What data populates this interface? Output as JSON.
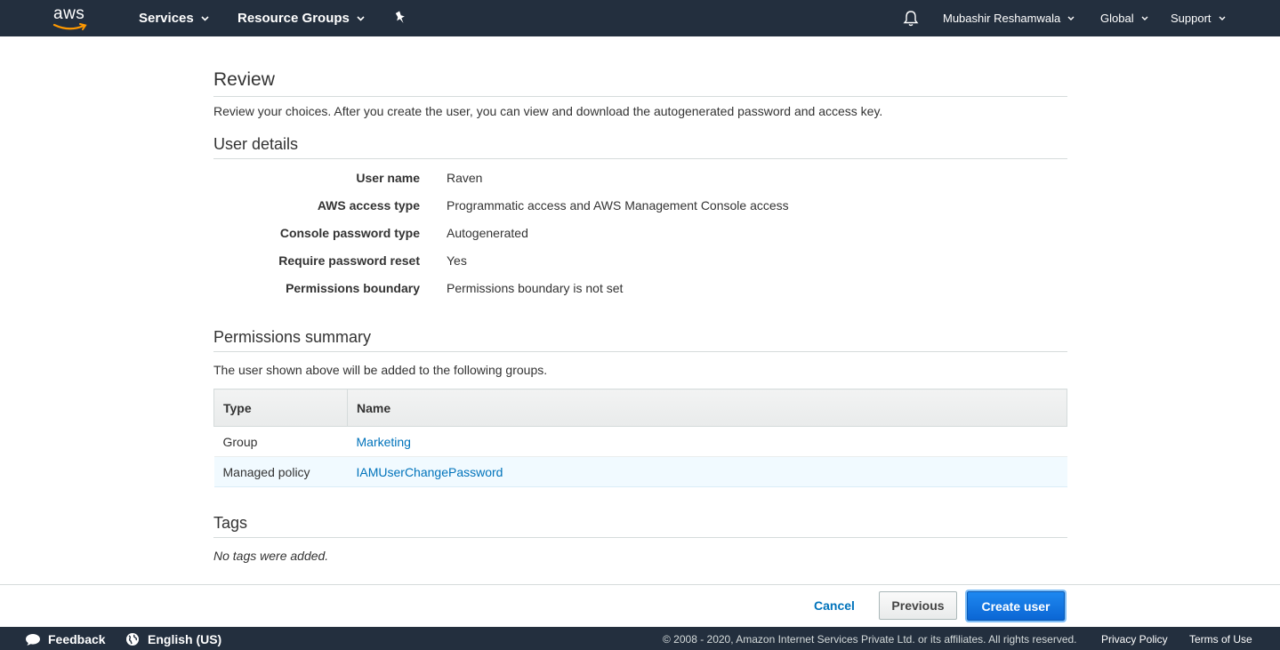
{
  "nav": {
    "logo_text": "aws",
    "services": "Services",
    "resource_groups": "Resource Groups",
    "user": "Mubashir Reshamwala",
    "region": "Global",
    "support": "Support"
  },
  "review": {
    "title": "Review",
    "description": "Review your choices. After you create the user, you can view and download the autogenerated password and access key."
  },
  "user_details": {
    "heading": "User details",
    "rows": [
      {
        "label": "User name",
        "value": "Raven"
      },
      {
        "label": "AWS access type",
        "value": "Programmatic access and AWS Management Console access"
      },
      {
        "label": "Console password type",
        "value": "Autogenerated"
      },
      {
        "label": "Require password reset",
        "value": "Yes"
      },
      {
        "label": "Permissions boundary",
        "value": "Permissions boundary is not set"
      }
    ]
  },
  "permissions": {
    "heading": "Permissions summary",
    "description": "The user shown above will be added to the following groups.",
    "columns": [
      "Type",
      "Name"
    ],
    "rows": [
      {
        "type": "Group",
        "name": "Marketing"
      },
      {
        "type": "Managed policy",
        "name": "IAMUserChangePassword"
      }
    ]
  },
  "tags": {
    "heading": "Tags",
    "empty": "No tags were added."
  },
  "actions": {
    "cancel": "Cancel",
    "previous": "Previous",
    "create": "Create user"
  },
  "footer": {
    "feedback": "Feedback",
    "language": "English (US)",
    "copyright": "© 2008 - 2020, Amazon Internet Services Private Ltd. or its affiliates. All rights reserved.",
    "privacy": "Privacy Policy",
    "terms": "Terms of Use"
  },
  "colors": {
    "nav_bg": "#232f3e",
    "link": "#0073bb",
    "primary_button": "#0b66d4",
    "aws_smile": "#ff9900"
  }
}
